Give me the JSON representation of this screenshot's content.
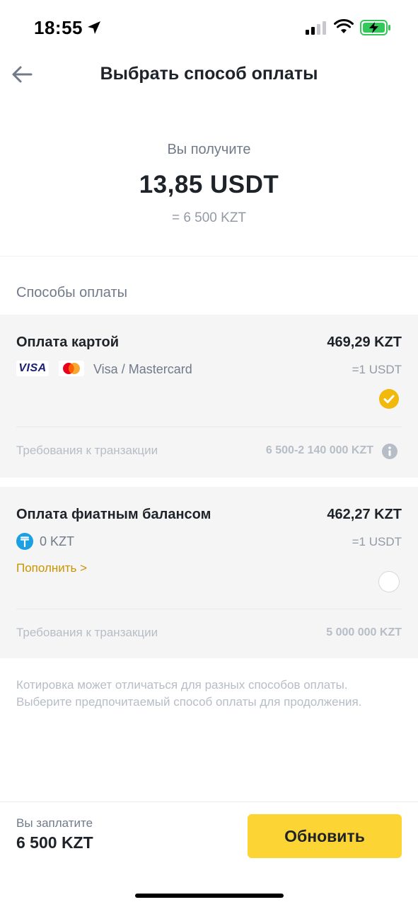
{
  "status_bar": {
    "time": "18:55",
    "icons": [
      "location-arrow-icon",
      "cellular-signal-icon",
      "wifi-icon",
      "battery-charging-icon"
    ]
  },
  "header": {
    "back_icon": "arrow-left-icon",
    "title": "Выбрать способ оплаты"
  },
  "receive": {
    "label": "Вы получите",
    "amount": "13,85 USDT",
    "equivalent": "= 6 500 KZT"
  },
  "payment_methods": {
    "section_title": "Способы оплаты",
    "card": {
      "title": "Оплата картой",
      "rate": "469,29 KZT",
      "subrate": "=1 USDT",
      "visa_logo_text": "VISA",
      "methods": "Visa / Mastercard",
      "selected": true,
      "requirements_label": "Требования к транзакции",
      "requirements_value": "6 500-2 140 000 KZT"
    },
    "fiat": {
      "title": "Оплата фиатным балансом",
      "rate": "462,27 KZT",
      "subrate": "=1 USDT",
      "balance": "0 KZT",
      "topup_label": "Пополнить >",
      "selected": false,
      "requirements_label": "Требования к транзакции",
      "requirements_value": "5 000 000 KZT"
    }
  },
  "disclaimer": "Котировка может отличаться для разных способов оплаты. Выберите предпочитаемый способ оплаты для продолжения.",
  "bottom_bar": {
    "pay_label": "Вы заплатите",
    "pay_amount": "6 500 KZT",
    "refresh_button": "Обновить"
  },
  "colors": {
    "accent": "#FCD535",
    "check": "#F0B90B",
    "link": "#C99400",
    "text_primary": "#1E2329",
    "text_secondary": "#707A8A",
    "card_background": "#F5F5F5"
  }
}
